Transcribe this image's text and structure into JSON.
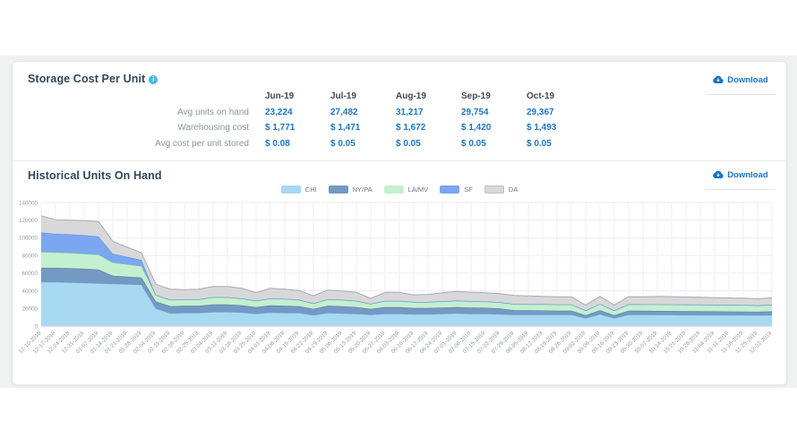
{
  "section_storage": {
    "title": "Storage Cost Per Unit",
    "download_label": "Download",
    "months": [
      "Jun-19",
      "Jul-19",
      "Aug-19",
      "Sep-19",
      "Oct-19"
    ],
    "rows": [
      {
        "label": "Avg units on hand",
        "values": [
          "23,224",
          "27,482",
          "31,217",
          "29,754",
          "29,367"
        ]
      },
      {
        "label": "Warehousing cost",
        "values": [
          "$ 1,771",
          "$ 1,471",
          "$ 1,672",
          "$ 1,420",
          "$ 1,493"
        ]
      },
      {
        "label": "Avg cost per unit stored",
        "values": [
          "$ 0.08",
          "$ 0.05",
          "$ 0.05",
          "$ 0.05",
          "$ 0.05"
        ]
      }
    ]
  },
  "section_history": {
    "title": "Historical Units On Hand",
    "download_label": "Download"
  },
  "colors": {
    "accent_blue": "#1b76c6",
    "title_navy": "#33465a",
    "page_background": "#f0f1f3",
    "card_border": "#e2e5e9",
    "info_icon_blue": "#41b9e9"
  },
  "chart_data": {
    "type": "area",
    "stacked": true,
    "title": "Historical Units On Hand",
    "xlabel": "",
    "ylabel": "",
    "ylim": [
      0,
      140000
    ],
    "yticks": [
      0,
      20000,
      40000,
      60000,
      80000,
      100000,
      120000,
      140000
    ],
    "grid": true,
    "legend_position": "top-center",
    "x": [
      "12-10-2018",
      "12-17-2018",
      "12-24-2018",
      "12-31-2018",
      "01-07-2019",
      "01-14-2019",
      "01-21-2019",
      "01-28-2019",
      "02-04-2019",
      "02-11-2019",
      "02-18-2019",
      "02-25-2019",
      "03-04-2019",
      "03-11-2019",
      "03-18-2019",
      "03-25-2019",
      "04-01-2019",
      "04-08-2019",
      "04-15-2019",
      "04-22-2019",
      "04-29-2019",
      "05-06-2019",
      "05-13-2019",
      "05-20-2019",
      "05-27-2019",
      "06-03-2019",
      "06-10-2019",
      "06-17-2019",
      "06-24-2019",
      "07-01-2019",
      "07-08-2019",
      "07-15-2019",
      "07-22-2019",
      "07-29-2019",
      "08-05-2019",
      "08-12-2019",
      "08-19-2019",
      "08-26-2019",
      "09-02-2019",
      "09-09-2019",
      "09-16-2019",
      "09-23-2019",
      "09-30-2019",
      "10-07-2019",
      "10-14-2019",
      "10-21-2019",
      "10-28-2019",
      "11-04-2019",
      "11-11-2019",
      "11-18-2019",
      "11-25-2019",
      "12-02-2019"
    ],
    "series": [
      {
        "name": "CHI",
        "fill": "#a8d9f3",
        "stroke": "#6fb3dd",
        "values": [
          50000,
          50000,
          49500,
          49000,
          48500,
          48000,
          47500,
          47000,
          20000,
          14500,
          15000,
          15000,
          16000,
          16000,
          15500,
          14000,
          15500,
          15000,
          15000,
          12500,
          15000,
          14500,
          14000,
          13000,
          14000,
          14000,
          13500,
          13500,
          14000,
          14500,
          14000,
          14000,
          13500,
          13000,
          13000,
          13000,
          13000,
          13000,
          9000,
          13500,
          9000,
          13000,
          13000,
          12800,
          12800,
          12600,
          12600,
          12500,
          12500,
          12400,
          12300,
          12500
        ]
      },
      {
        "name": "NY/PA",
        "fill": "#7599c3",
        "stroke": "#53779f",
        "values": [
          16000,
          16000,
          16000,
          16000,
          15500,
          9000,
          8500,
          8000,
          8000,
          8000,
          8000,
          8000,
          8500,
          8500,
          8000,
          7500,
          8000,
          8000,
          7500,
          7000,
          8000,
          8000,
          7500,
          6500,
          7500,
          7500,
          7000,
          7000,
          7000,
          7000,
          7000,
          6800,
          6500,
          5000,
          5000,
          4800,
          4500,
          4500,
          3500,
          4500,
          3500,
          4500,
          4400,
          4400,
          4300,
          4300,
          4200,
          4200,
          4100,
          4100,
          4000,
          4200
        ]
      },
      {
        "name": "LA/MV",
        "fill": "#c4f0cf",
        "stroke": "#8bd3a0",
        "values": [
          18000,
          17500,
          17500,
          17000,
          17000,
          15000,
          14000,
          13000,
          7000,
          7000,
          7000,
          7000,
          8000,
          8000,
          7500,
          7000,
          7500,
          7500,
          7000,
          6000,
          7000,
          7000,
          6800,
          5500,
          6800,
          6800,
          6500,
          6500,
          6800,
          7000,
          7000,
          6800,
          6800,
          6800,
          6800,
          6800,
          6800,
          6800,
          5000,
          6800,
          5000,
          7000,
          7000,
          7200,
          7200,
          7200,
          7200,
          7000,
          7000,
          7000,
          6800,
          7000
        ]
      },
      {
        "name": "SF",
        "fill": "#7aa7f0",
        "stroke": "#5b8ce2",
        "values": [
          22000,
          21000,
          21000,
          21000,
          20500,
          10000,
          8500,
          7000,
          400,
          400,
          400,
          400,
          400,
          400,
          400,
          400,
          400,
          400,
          400,
          400,
          400,
          400,
          400,
          400,
          400,
          400,
          400,
          400,
          400,
          400,
          400,
          400,
          400,
          400,
          400,
          400,
          400,
          400,
          400,
          400,
          400,
          400,
          400,
          400,
          400,
          400,
          400,
          400,
          400,
          400,
          400,
          400
        ]
      },
      {
        "name": "DA",
        "fill": "#d8d8da",
        "stroke": "#ababaf",
        "swatch_border": "#bfc2c5",
        "values": [
          19000,
          16000,
          16000,
          16500,
          17000,
          14000,
          11000,
          8000,
          12000,
          12000,
          11000,
          11500,
          12000,
          12000,
          11500,
          9000,
          11500,
          11000,
          10500,
          8500,
          10500,
          10000,
          9500,
          6000,
          9500,
          9500,
          8000,
          8500,
          9500,
          10500,
          10000,
          9800,
          9500,
          9500,
          9000,
          8800,
          8500,
          8500,
          6000,
          8500,
          6000,
          8500,
          8500,
          8800,
          8800,
          8600,
          8400,
          8200,
          8000,
          7800,
          7500,
          8000
        ]
      }
    ]
  }
}
